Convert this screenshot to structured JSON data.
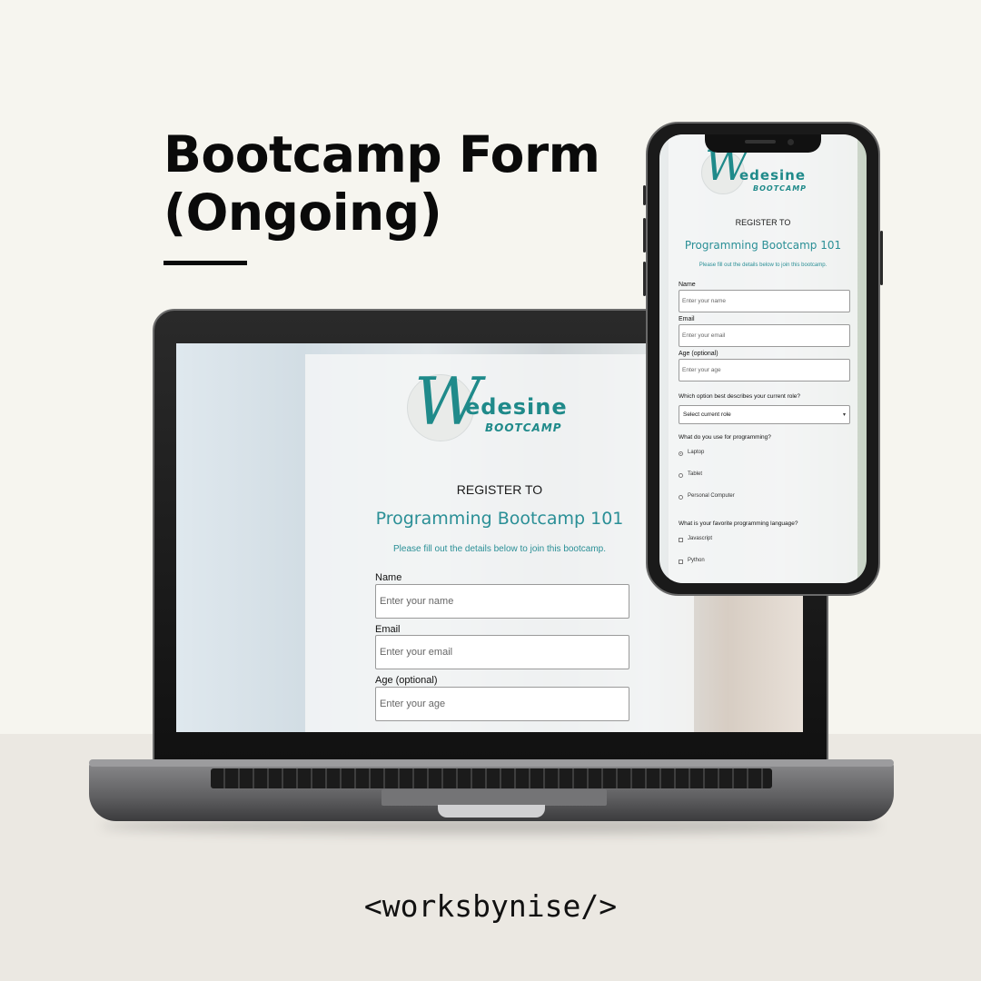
{
  "headline": {
    "line1": "Bootcamp Form",
    "line2": "(Ongoing)"
  },
  "footer": {
    "text": "<worksbynise/>"
  },
  "brand": {
    "w": "W",
    "word": "edesine",
    "sub": "BOOTCAMP",
    "accent": "#2a8f96"
  },
  "form": {
    "register": "REGISTER TO",
    "course": "Programming Bootcamp 101",
    "description": "Please fill out the details below to join this bootcamp.",
    "name_label": "Name",
    "name_placeholder": "Enter your name",
    "email_label": "Email",
    "email_placeholder": "Enter your email",
    "age_label": "Age (optional)",
    "age_placeholder": "Enter your age",
    "role_question": "Which option best describes your current role?",
    "role_select": "Select current role",
    "device_question": "What do you use for programming?",
    "device_options": [
      "Laptop",
      "Tablet",
      "Personal Computer"
    ],
    "device_selected": "Laptop",
    "language_question": "What is your favorite programming language?",
    "language_options": [
      "Javascript",
      "Python"
    ]
  }
}
